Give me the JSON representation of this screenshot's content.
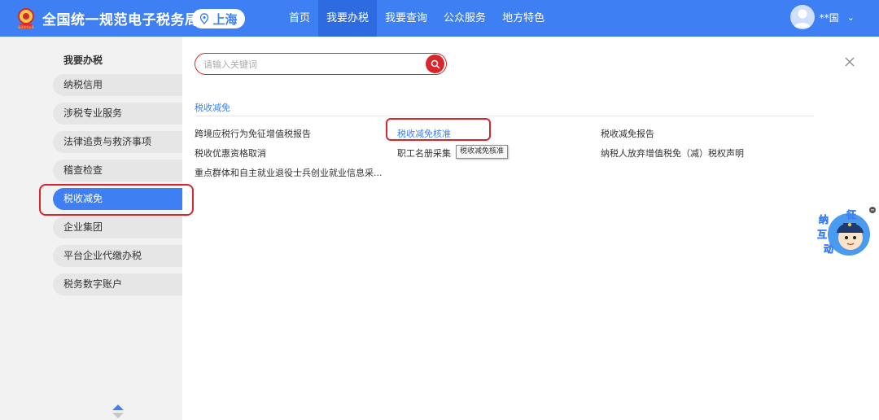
{
  "header": {
    "site_title": "全国统一规范电子税务局",
    "region": "上海",
    "nav": [
      "首页",
      "我要办税",
      "我要查询",
      "公众服务",
      "地方特色"
    ],
    "user_name": "**国",
    "emblem_caption": "国家税务总局"
  },
  "sidebar": {
    "heading": "我要办税",
    "items": [
      {
        "label": "纳税信用"
      },
      {
        "label": "涉税专业服务"
      },
      {
        "label": "法律追责与救济事项"
      },
      {
        "label": "稽查检查"
      },
      {
        "label": "税收减免"
      },
      {
        "label": "企业集团"
      },
      {
        "label": "平台企业代缴办税"
      },
      {
        "label": "税务数字账户"
      }
    ]
  },
  "main": {
    "search_placeholder": "请输入关键词",
    "category": "税收减免",
    "links": [
      "跨境应税行为免征增值税报告",
      "税收减免核准",
      "税收减免报告",
      "税收优惠资格取消",
      "职工名册采集",
      "纳税人放弃增值税免（减）税权声明",
      "重点群体和自主就业退役士兵创业就业信息采..."
    ],
    "tooltip": "税收减免核准"
  },
  "mascot": {
    "chars": [
      "征",
      "纳",
      "互",
      "动"
    ]
  },
  "colors": {
    "brand_blue": "#3e7ff4",
    "highlight_red": "#d9262c"
  }
}
